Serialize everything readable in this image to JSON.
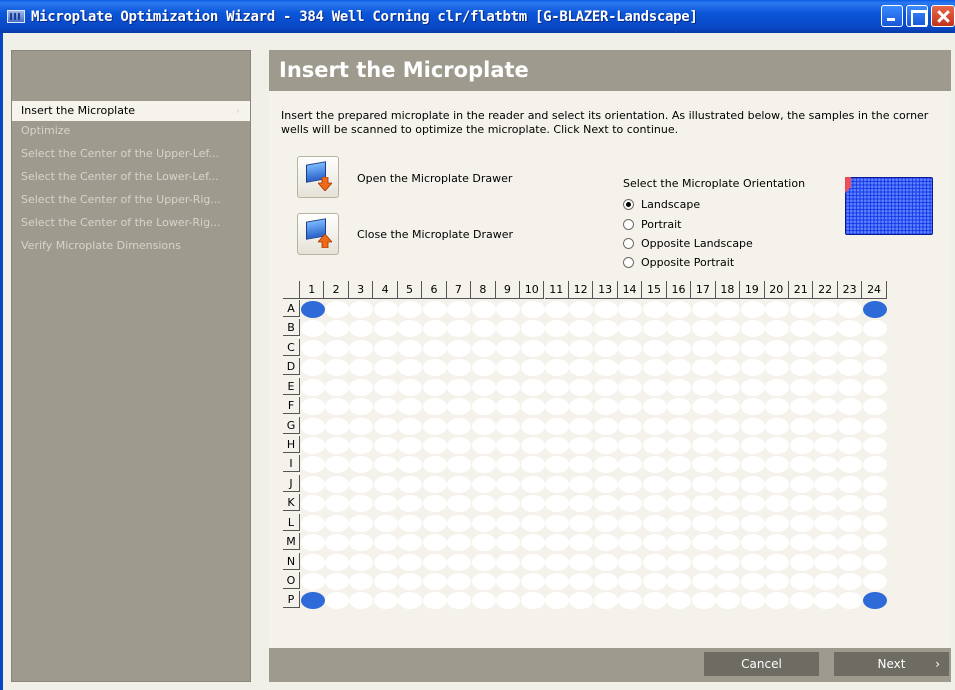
{
  "window": {
    "title": "Microplate Optimization Wizard - 384 Well Corning clr/flatbtm [G-BLAZER-Landscape]"
  },
  "nav": {
    "items": [
      {
        "label": "Insert the Microplate",
        "active": true
      },
      {
        "label": "Optimize",
        "active": false
      },
      {
        "label": "Select the Center of the Upper-Lef...",
        "active": false
      },
      {
        "label": "Select the Center of the Lower-Lef...",
        "active": false
      },
      {
        "label": "Select the Center of the Upper-Rig...",
        "active": false
      },
      {
        "label": "Select the Center of the Lower-Rig...",
        "active": false
      },
      {
        "label": "Verify Microplate Dimensions",
        "active": false
      }
    ]
  },
  "main": {
    "heading": "Insert the Microplate",
    "description": "Insert the prepared microplate in the reader and select its orientation. As illustrated below, the samples in the corner wells will be scanned to optimize the microplate. Click Next to continue.",
    "open_drawer_label": "Open the Microplate Drawer",
    "close_drawer_label": "Close the Microplate Drawer",
    "orientation": {
      "title": "Select the Microplate Orientation",
      "options": [
        "Landscape",
        "Portrait",
        "Opposite Landscape",
        "Opposite Portrait"
      ],
      "selected": "Landscape"
    }
  },
  "plate": {
    "columns": [
      "1",
      "2",
      "3",
      "4",
      "5",
      "6",
      "7",
      "8",
      "9",
      "10",
      "11",
      "12",
      "13",
      "14",
      "15",
      "16",
      "17",
      "18",
      "19",
      "20",
      "21",
      "22",
      "23",
      "24"
    ],
    "rows": [
      "A",
      "B",
      "C",
      "D",
      "E",
      "F",
      "G",
      "H",
      "I",
      "J",
      "K",
      "L",
      "M",
      "N",
      "O",
      "P"
    ],
    "highlighted_wells": [
      "A1",
      "A24",
      "P1",
      "P24"
    ],
    "colors": {
      "well": "#ffffff",
      "highlighted": "#2e6ad8"
    }
  },
  "buttons": {
    "cancel": "Cancel",
    "next": "Next",
    "next_chevron": "›"
  }
}
